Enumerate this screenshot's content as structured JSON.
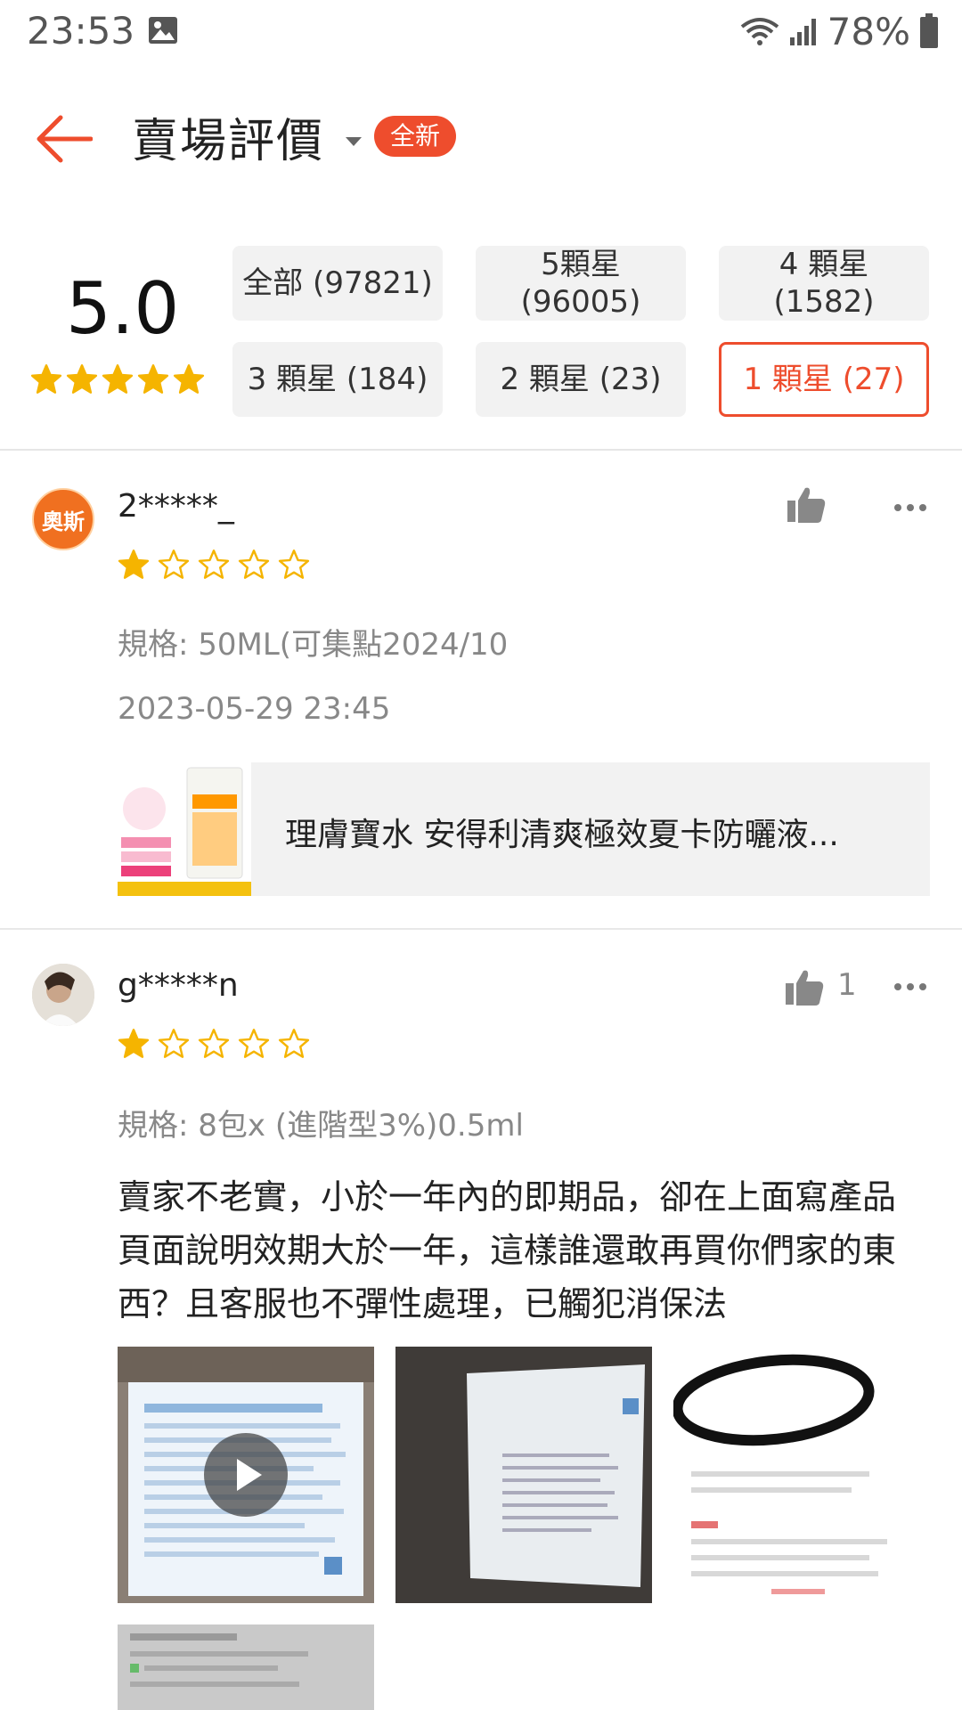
{
  "status_bar": {
    "time": "23:53",
    "battery": "78%"
  },
  "header": {
    "title": "賣場評價",
    "badge": "全新"
  },
  "summary": {
    "average": "5.0",
    "stars": 5,
    "filters": [
      {
        "label": "全部 (97821)",
        "active": false
      },
      {
        "label": "5顆星\n(96005)",
        "active": false
      },
      {
        "label": "4 顆星\n(1582)",
        "active": false
      },
      {
        "label": "3 顆星 (184)",
        "active": false
      },
      {
        "label": "2 顆星 (23)",
        "active": false
      },
      {
        "label": "1 顆星 (27)",
        "active": true
      }
    ]
  },
  "reviews": [
    {
      "avatar_text": "奧斯",
      "username": "2*****_",
      "stars": 1,
      "likes": "",
      "variation": "規格: 50ML(可集點2024/10",
      "date": "2023-05-29 23:45",
      "product_name": "理膚寶水 安得利清爽極效夏卡防曬液..."
    },
    {
      "username": "g*****n",
      "stars": 1,
      "likes": "1",
      "variation": "規格: 8包x (進階型3%)0.5ml",
      "comment": "賣家不老實，小於一年內的即期品，卻在上面寫產品頁面說明效期大於一年，這樣誰還敢再買你們家的東西？且客服也不彈性處理，已觸犯消保法"
    }
  ],
  "colors": {
    "accent": "#ee4d2d",
    "star": "#f5b400"
  },
  "icons": [
    "image-icon",
    "wifi-icon",
    "signal-icon",
    "battery-icon",
    "back-arrow-icon",
    "dropdown-caret-icon",
    "star-icon",
    "thumbs-up-icon",
    "more-icon",
    "play-icon"
  ]
}
